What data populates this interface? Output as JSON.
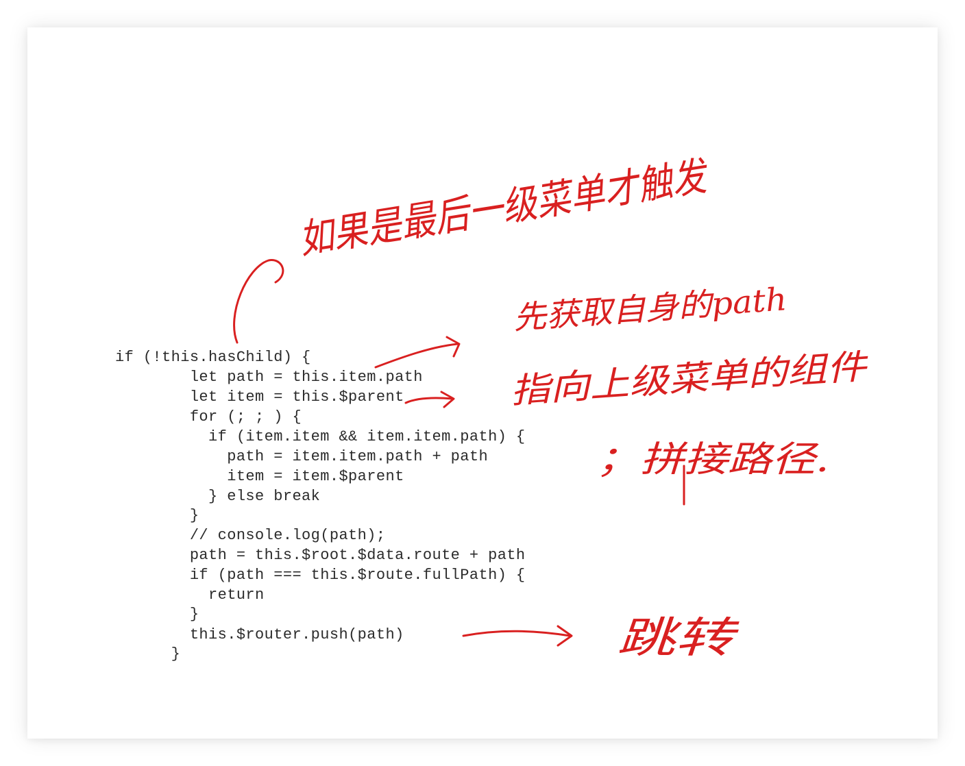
{
  "code_lines": [
    "if (!this.hasChild) {",
    "        let path = this.item.path",
    "        let item = this.$parent",
    "        for (; ; ) {",
    "          if (item.item && item.item.path) {",
    "            path = item.item.path + path",
    "            item = item.$parent",
    "          } else break",
    "        }",
    "        // console.log(path);",
    "        path = this.$root.$data.route + path",
    "        if (path === this.$route.fullPath) {",
    "          return",
    "        }",
    "        this.$router.push(path)",
    "      }"
  ],
  "annotations": {
    "top_note": "如果是最后一级菜单才触发",
    "get_path_note": "先获取自身的path",
    "parent_note": "指向上级菜单的组件",
    "concat_note": "；拼接路径.",
    "navigate_note": "跳转"
  },
  "colors": {
    "ink": "#d92020",
    "code_text": "#2b2b2b"
  }
}
